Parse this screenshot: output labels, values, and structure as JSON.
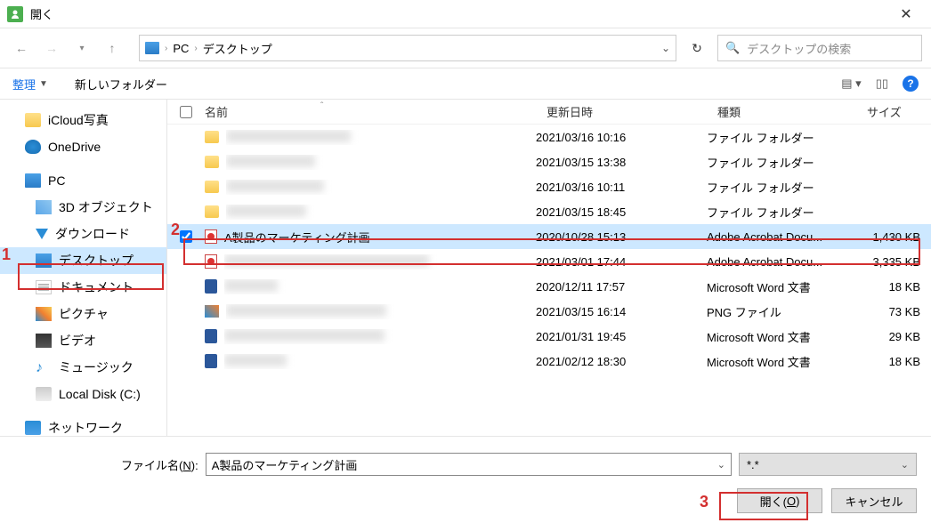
{
  "title": "開く",
  "breadcrumb": {
    "pc": "PC",
    "desktop": "デスクトップ"
  },
  "search_placeholder": "デスクトップの検索",
  "toolbar": {
    "organize": "整理",
    "new_folder": "新しいフォルダー"
  },
  "sidebar": {
    "icloud": "iCloud写真",
    "onedrive": "OneDrive",
    "pc": "PC",
    "objects3d": "3D オブジェクト",
    "downloads": "ダウンロード",
    "desktop": "デスクトップ",
    "documents": "ドキュメント",
    "pictures": "ピクチャ",
    "videos": "ビデオ",
    "music": "ミュージック",
    "localdisk": "Local Disk (C:)",
    "network": "ネットワーク"
  },
  "columns": {
    "name": "名前",
    "date": "更新日時",
    "type": "種類",
    "size": "サイズ"
  },
  "files": [
    {
      "name": "",
      "date": "2021/03/16 10:16",
      "type": "ファイル フォルダー",
      "size": "",
      "icon": "folder",
      "blur": true
    },
    {
      "name": "",
      "date": "2021/03/15 13:38",
      "type": "ファイル フォルダー",
      "size": "",
      "icon": "folder",
      "blur": true
    },
    {
      "name": "",
      "date": "2021/03/16 10:11",
      "type": "ファイル フォルダー",
      "size": "",
      "icon": "folder",
      "blur": true
    },
    {
      "name": "",
      "date": "2021/03/15 18:45",
      "type": "ファイル フォルダー",
      "size": "",
      "icon": "folder",
      "blur": true
    },
    {
      "name": "A製品のマーケティング計画",
      "date": "2020/10/28 15:13",
      "type": "Adobe Acrobat Docu...",
      "size": "1,430 KB",
      "icon": "pdf",
      "selected": true
    },
    {
      "name": "",
      "date": "2021/03/01 17:44",
      "type": "Adobe Acrobat Docu...",
      "size": "3,335 KB",
      "icon": "pdf",
      "blur": true
    },
    {
      "name": "",
      "date": "2020/12/11 17:57",
      "type": "Microsoft Word 文書",
      "size": "18 KB",
      "icon": "word",
      "blur": true
    },
    {
      "name": "",
      "date": "2021/03/15 16:14",
      "type": "PNG ファイル",
      "size": "73 KB",
      "icon": "png",
      "blur": true
    },
    {
      "name": "",
      "date": "2021/01/31 19:45",
      "type": "Microsoft Word 文書",
      "size": "29 KB",
      "icon": "word",
      "blur": true
    },
    {
      "name": "",
      "date": "2021/02/12 18:30",
      "type": "Microsoft Word 文書",
      "size": "18 KB",
      "icon": "word",
      "blur": true
    }
  ],
  "footer": {
    "filename_label_pre": "ファイル名(",
    "filename_label_key": "N",
    "filename_label_post": "):",
    "filename_value": "A製品のマーケティング計画",
    "filetype": "*.*",
    "open_pre": "開く(",
    "open_key": "O",
    "open_post": ")",
    "cancel": "キャンセル"
  },
  "annotations": {
    "a1": "1",
    "a2": "2",
    "a3": "3"
  }
}
